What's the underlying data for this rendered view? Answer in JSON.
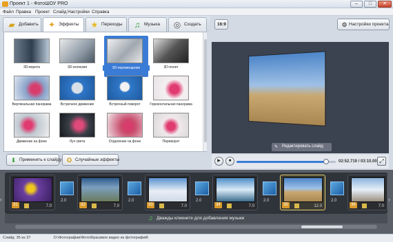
{
  "window": {
    "title": "Проект 1 - ФотоШОУ PRO",
    "minimize": "–",
    "maximize": "□",
    "close": "✕"
  },
  "menu": [
    "Файл",
    "Правка",
    "Проект",
    "Слайд",
    "Настройки",
    "Справка"
  ],
  "tabs": [
    {
      "label": "Добавить",
      "icon": "folder-icon"
    },
    {
      "label": "Эффекты",
      "icon": "magic-wand-icon",
      "active": true
    },
    {
      "label": "Переходы",
      "icon": "star-icon"
    },
    {
      "label": "Музыка",
      "icon": "music-note-icon"
    },
    {
      "label": "Создать",
      "icon": "film-reel-icon"
    }
  ],
  "aspect_button": "16:9",
  "project_settings_button": "Настройки проекта",
  "effects": [
    {
      "label": "3D-ворота"
    },
    {
      "label": "3D-иллюзия"
    },
    {
      "label": "3D-перемещение",
      "selected": true
    },
    {
      "label": "3D-полет"
    },
    {
      "label": "Вертикальная панорама"
    },
    {
      "label": "Встречное движение"
    },
    {
      "label": "Встречный поворот"
    },
    {
      "label": "Горизонтальная панорама"
    },
    {
      "label": "Движение на фоне"
    },
    {
      "label": "Луч света"
    },
    {
      "label": "Отдаление на фоне"
    },
    {
      "label": "Переворот"
    }
  ],
  "apply_button": "Применить к слайду",
  "random_button": "Случайные эффекты",
  "edit_slide_button": "Редактировать слайд",
  "player": {
    "time": "02:52.719 / 03:10.000",
    "progress": 0.905
  },
  "slides": [
    {
      "num": "31",
      "duration": "7.0"
    },
    {
      "num": "32",
      "duration": "7.0"
    },
    {
      "num": "33",
      "duration": "7.0"
    },
    {
      "num": "34",
      "duration": "7.0"
    },
    {
      "num": "35",
      "duration": "12.0",
      "selected": true
    },
    {
      "num": "36",
      "duration": "7.0"
    }
  ],
  "transitions": [
    "2.0",
    "2.0",
    "2.0",
    "2.0",
    "2.0",
    "2.0"
  ],
  "music_hint": "Дважды кликните для добавления музыки",
  "status": {
    "slides": "Слайд: 35 из 37",
    "path": "D:\\Фотографии\\Фото\\Красивое видео из фотографий\\"
  },
  "colors": {
    "accent": "#3a7bd5",
    "timeline_bg": "#5a5f68",
    "slide_number": "#d99a2a"
  }
}
